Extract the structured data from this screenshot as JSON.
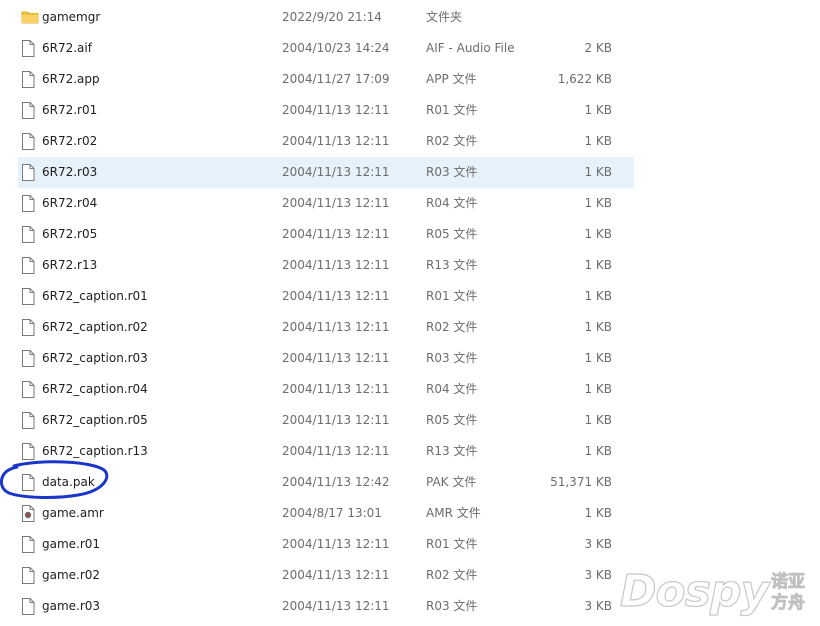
{
  "colors": {
    "selected_row": "#e5f1fb",
    "annotation": "#1a36c8",
    "folder": "#f3c13a"
  },
  "files": [
    {
      "name": "gamemgr",
      "date": "2022/9/20 21:14",
      "type": "文件夹",
      "size": "",
      "icon": "folder-icon"
    },
    {
      "name": "6R72.aif",
      "date": "2004/10/23 14:24",
      "type": "AIF - Audio File",
      "size": "2 KB",
      "icon": "file-icon"
    },
    {
      "name": "6R72.app",
      "date": "2004/11/27 17:09",
      "type": "APP 文件",
      "size": "1,622 KB",
      "icon": "file-icon"
    },
    {
      "name": "6R72.r01",
      "date": "2004/11/13 12:11",
      "type": "R01 文件",
      "size": "1 KB",
      "icon": "file-icon"
    },
    {
      "name": "6R72.r02",
      "date": "2004/11/13 12:11",
      "type": "R02 文件",
      "size": "1 KB",
      "icon": "file-icon"
    },
    {
      "name": "6R72.r03",
      "date": "2004/11/13 12:11",
      "type": "R03 文件",
      "size": "1 KB",
      "icon": "file-icon",
      "selected": true
    },
    {
      "name": "6R72.r04",
      "date": "2004/11/13 12:11",
      "type": "R04 文件",
      "size": "1 KB",
      "icon": "file-icon"
    },
    {
      "name": "6R72.r05",
      "date": "2004/11/13 12:11",
      "type": "R05 文件",
      "size": "1 KB",
      "icon": "file-icon"
    },
    {
      "name": "6R72.r13",
      "date": "2004/11/13 12:11",
      "type": "R13 文件",
      "size": "1 KB",
      "icon": "file-icon"
    },
    {
      "name": "6R72_caption.r01",
      "date": "2004/11/13 12:11",
      "type": "R01 文件",
      "size": "1 KB",
      "icon": "file-icon"
    },
    {
      "name": "6R72_caption.r02",
      "date": "2004/11/13 12:11",
      "type": "R02 文件",
      "size": "1 KB",
      "icon": "file-icon"
    },
    {
      "name": "6R72_caption.r03",
      "date": "2004/11/13 12:11",
      "type": "R03 文件",
      "size": "1 KB",
      "icon": "file-icon"
    },
    {
      "name": "6R72_caption.r04",
      "date": "2004/11/13 12:11",
      "type": "R04 文件",
      "size": "1 KB",
      "icon": "file-icon"
    },
    {
      "name": "6R72_caption.r05",
      "date": "2004/11/13 12:11",
      "type": "R05 文件",
      "size": "1 KB",
      "icon": "file-icon"
    },
    {
      "name": "6R72_caption.r13",
      "date": "2004/11/13 12:11",
      "type": "R13 文件",
      "size": "1 KB",
      "icon": "file-icon"
    },
    {
      "name": "data.pak",
      "date": "2004/11/13 12:42",
      "type": "PAK 文件",
      "size": "51,371 KB",
      "icon": "file-icon",
      "annotated": true
    },
    {
      "name": "game.amr",
      "date": "2004/8/17 13:01",
      "type": "AMR 文件",
      "size": "1 KB",
      "icon": "audio-file-icon"
    },
    {
      "name": "game.r01",
      "date": "2004/11/13 12:11",
      "type": "R01 文件",
      "size": "3 KB",
      "icon": "file-icon"
    },
    {
      "name": "game.r02",
      "date": "2004/11/13 12:11",
      "type": "R02 文件",
      "size": "3 KB",
      "icon": "file-icon"
    },
    {
      "name": "game.r03",
      "date": "2004/11/13 12:11",
      "type": "R03 文件",
      "size": "3 KB",
      "icon": "file-icon"
    }
  ],
  "watermark": {
    "brand": "Dospy",
    "cn_line1": "诺亚",
    "cn_line2": "方舟"
  }
}
